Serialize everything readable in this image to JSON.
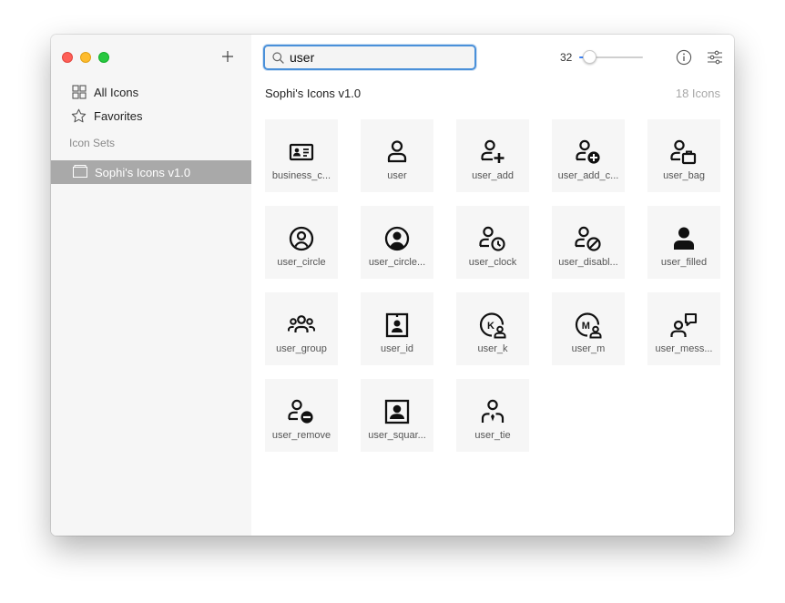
{
  "sidebar": {
    "items": [
      {
        "label": "All Icons",
        "icon": "grid-icon"
      },
      {
        "label": "Favorites",
        "icon": "star-icon"
      }
    ],
    "section_label": "Icon Sets",
    "sets": [
      {
        "label": "Sophi's Icons v1.0",
        "icon": "folder-icon",
        "selected": true
      }
    ]
  },
  "toolbar": {
    "search_value": "user",
    "size_value": "32",
    "size_fraction": 0.15,
    "accent_color": "#3b82f6"
  },
  "main": {
    "set_title": "Sophi's Icons v1.0",
    "count_label": "18 Icons",
    "icons": [
      {
        "name": "business_c...",
        "icon": "business-card-icon"
      },
      {
        "name": "user",
        "icon": "user-icon"
      },
      {
        "name": "user_add",
        "icon": "user-add-icon"
      },
      {
        "name": "user_add_c...",
        "icon": "user-add-circle-icon"
      },
      {
        "name": "user_bag",
        "icon": "user-bag-icon"
      },
      {
        "name": "user_circle",
        "icon": "user-circle-icon"
      },
      {
        "name": "user_circle...",
        "icon": "user-circle-filled-icon"
      },
      {
        "name": "user_clock",
        "icon": "user-clock-icon"
      },
      {
        "name": "user_disabl...",
        "icon": "user-disabled-icon"
      },
      {
        "name": "user_filled",
        "icon": "user-filled-icon"
      },
      {
        "name": "user_group",
        "icon": "user-group-icon"
      },
      {
        "name": "user_id",
        "icon": "user-id-icon"
      },
      {
        "name": "user_k",
        "icon": "user-k-icon"
      },
      {
        "name": "user_m",
        "icon": "user-m-icon"
      },
      {
        "name": "user_mess...",
        "icon": "user-message-icon"
      },
      {
        "name": "user_remove",
        "icon": "user-remove-icon"
      },
      {
        "name": "user_squar...",
        "icon": "user-square-icon"
      },
      {
        "name": "user_tie",
        "icon": "user-tie-icon"
      }
    ]
  }
}
